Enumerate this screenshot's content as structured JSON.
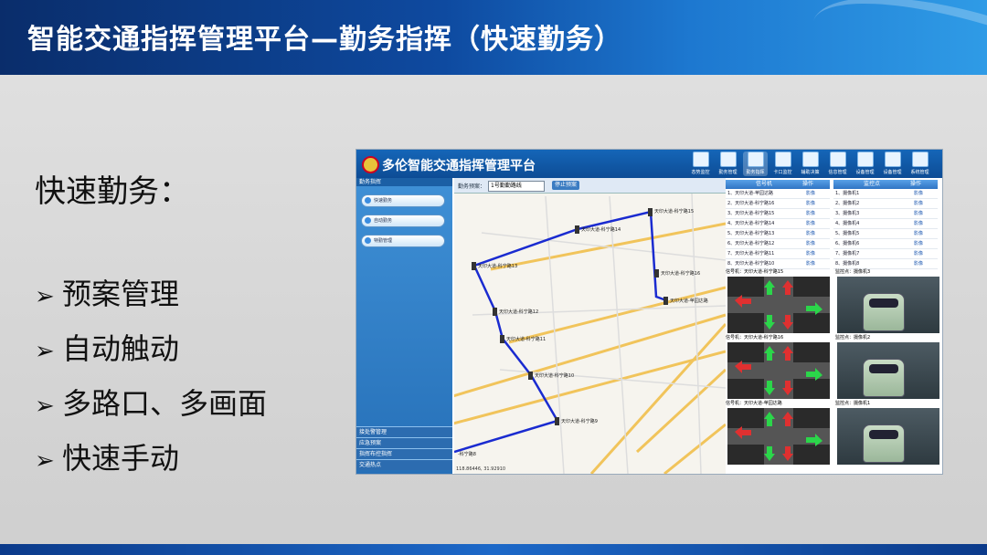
{
  "slide": {
    "title": "智能交通指挥管理平台—勤务指挥（快速勤务）",
    "subtitle": "快速勤务：",
    "bullets": [
      "预案管理",
      "自动触动",
      "多路口、多画面",
      "快速手动"
    ],
    "bullet_marker": "➢"
  },
  "app": {
    "title": "多伦智能交通指挥管理平台",
    "nav": [
      "态势监控",
      "勤务管理",
      "勤务指挥",
      "卡口监控",
      "辅助决策",
      "信息管理",
      "设备管理",
      "设备管理",
      "系统管理"
    ],
    "left_header": "勤务指挥",
    "left_menu": [
      "快速勤务",
      "自动勤务",
      "特勤管理"
    ],
    "left_accordion": [
      "接处警管理",
      "应急预案",
      "指挥布控指挥",
      "交通热点"
    ],
    "toolbar": {
      "label": "勤务预案：",
      "select_value": "1号勤勤路线",
      "button": "停止预案"
    },
    "coords": "118.86446, 31.92910",
    "map_route_labels": [
      "天印大道-科宁路15",
      "天印大道-科宁路14",
      "天印大道-科宁路13",
      "天印大道-科宁路12",
      "天印大道-科宁路11",
      "天印大道-科宁路10",
      "天印大道-科宁路9",
      "天印大道-科宁路16",
      "天印大道-苹园达路",
      "-科宁路8"
    ],
    "signal_table": {
      "headers": [
        "信号机",
        "操作"
      ],
      "rows": [
        "1、天印大道-苹园达路",
        "2、天印大道-科宁路16",
        "3、天印大道-科宁路15",
        "4、天印大道-科宁路14",
        "5、天印大道-科宁路13",
        "6、天印大道-科宁路12",
        "7、天印大道-科宁路11",
        "8、天印大道-科宁路10"
      ],
      "action": "影像"
    },
    "camera_table": {
      "headers": [
        "监控点",
        "操作"
      ],
      "rows": [
        "1、摄像机1",
        "2、摄像机2",
        "3、摄像机3",
        "4、摄像机4",
        "5、摄像机5",
        "6、摄像机6",
        "7、摄像机7",
        "8、摄像机8"
      ],
      "action": "影像"
    },
    "signal_panels": [
      "信号机：天印大道-科宁路15",
      "信号机：天印大道-科宁路16",
      "信号机：天印大道-苹园达路"
    ],
    "camera_panels": [
      "监控点：摄像机3",
      "监控点：摄像机2",
      "监控点：摄像机1"
    ]
  }
}
